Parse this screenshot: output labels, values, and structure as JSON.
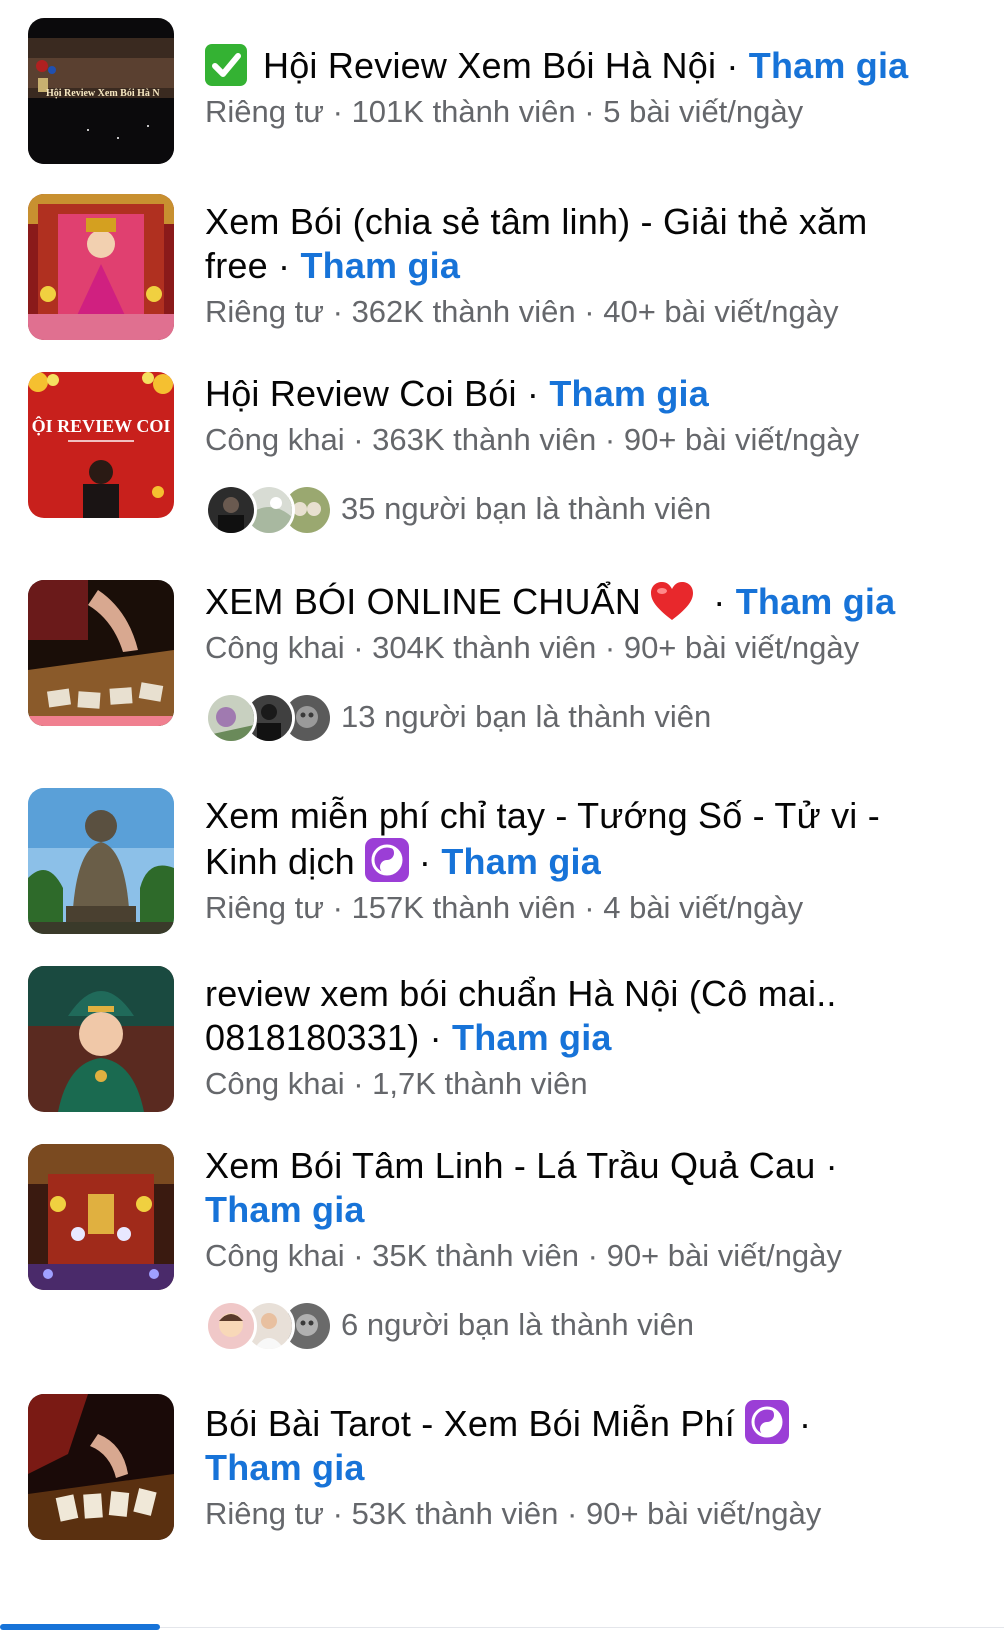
{
  "join_label": "Tham gia",
  "separator": "·",
  "groups": [
    {
      "title": "Hội Review Xem Bói Hà Nội",
      "thumb_text": "Hội Review Xem Bói Hà N",
      "privacy": "Riêng tư",
      "members": "101K thành viên",
      "posts": "5 bài viết/ngày",
      "badge": "check-mark-emoji"
    },
    {
      "title": "Xem Bói (chia sẻ tâm linh) - Giải thẻ xăm free",
      "privacy": "Riêng tư",
      "members": "362K thành viên",
      "posts": "40+ bài viết/ngày"
    },
    {
      "title": "Hội Review Coi Bói",
      "thumb_text": "ỘI REVIEW COI",
      "privacy": "Công khai",
      "members": "363K thành viên",
      "posts": "90+ bài viết/ngày",
      "friends": "35 người bạn là thành viên"
    },
    {
      "title": "XEM BÓI ONLINE CHUẨN",
      "privacy": "Công khai",
      "members": "304K thành viên",
      "posts": "90+ bài viết/ngày",
      "friends": "13 người bạn là thành viên",
      "badge": "red-heart-emoji"
    },
    {
      "title": "Xem miễn phí chỉ tay - Tướng Số - Tử vi - Kinh dịch",
      "privacy": "Riêng tư",
      "members": "157K thành viên",
      "posts": "4 bài viết/ngày",
      "badge": "yin-yang-emoji"
    },
    {
      "title": "review xem bói chuẩn Hà Nội (Cô mai.. 0818180331)",
      "privacy": "Công khai",
      "members": "1,7K thành viên"
    },
    {
      "title": "Xem Bói Tâm Linh - Lá Trầu Quả Cau",
      "privacy": "Công khai",
      "members": "35K thành viên",
      "posts": "90+ bài viết/ngày",
      "friends": "6 người bạn là thành viên"
    },
    {
      "title": "Bói Bài Tarot - Xem Bói Miễn Phí",
      "privacy": "Riêng tư",
      "members": "53K thành viên",
      "posts": "90+ bài viết/ngày",
      "badge": "yin-yang-emoji"
    }
  ],
  "colors": {
    "link": "#1773d8",
    "meta_text": "#65676b",
    "title_text": "#050505"
  }
}
